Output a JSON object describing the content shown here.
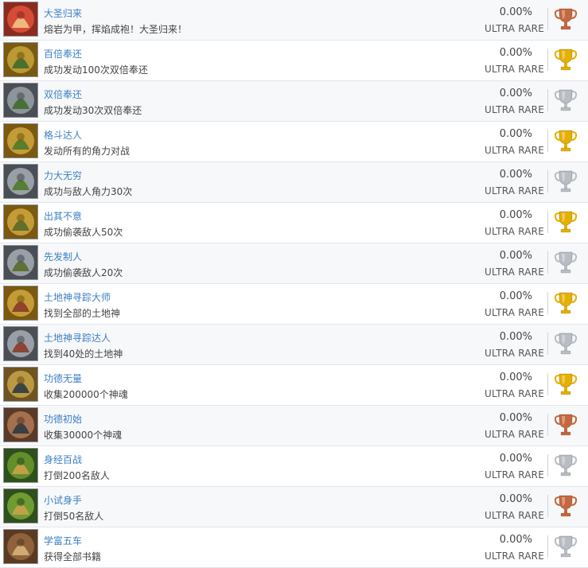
{
  "colors": {
    "title_link": "#3b7fc4",
    "gold": "#e6b000",
    "silver": "#b9bec4",
    "bronze": "#c6683f"
  },
  "achievements": [
    {
      "title": "大圣归来",
      "desc": "熔岩为甲，挥焰成袍！大圣归来！",
      "percent": "0.00%",
      "rarity": "ULTRA RARE",
      "trophy": "bronze",
      "icon": "monkey-king-red-icon"
    },
    {
      "title": "百倍奉还",
      "desc": "成功发动100次双倍奉还",
      "percent": "0.00%",
      "rarity": "ULTRA RARE",
      "trophy": "gold",
      "icon": "fighters-gold-icon"
    },
    {
      "title": "双倍奉还",
      "desc": "成功发动30次双倍奉还",
      "percent": "0.00%",
      "rarity": "ULTRA RARE",
      "trophy": "silver",
      "icon": "fighters-silver-icon"
    },
    {
      "title": "格斗达人",
      "desc": "发动所有的角力对战",
      "percent": "0.00%",
      "rarity": "ULTRA RARE",
      "trophy": "gold",
      "icon": "brawl-gold-icon"
    },
    {
      "title": "力大无穷",
      "desc": "成功与敌人角力30次",
      "percent": "0.00%",
      "rarity": "ULTRA RARE",
      "trophy": "silver",
      "icon": "brawl-silver-icon"
    },
    {
      "title": "出其不意",
      "desc": "成功偷袭敌人50次",
      "percent": "0.00%",
      "rarity": "ULTRA RARE",
      "trophy": "gold",
      "icon": "ambush-gold-icon"
    },
    {
      "title": "先发制人",
      "desc": "成功偷袭敌人20次",
      "percent": "0.00%",
      "rarity": "ULTRA RARE",
      "trophy": "silver",
      "icon": "ambush-silver-icon"
    },
    {
      "title": "土地神寻踪大师",
      "desc": "找到全部的土地神",
      "percent": "0.00%",
      "rarity": "ULTRA RARE",
      "trophy": "gold",
      "icon": "earth-god-gold-icon"
    },
    {
      "title": "土地神寻踪达人",
      "desc": "找到40处的土地神",
      "percent": "0.00%",
      "rarity": "ULTRA RARE",
      "trophy": "silver",
      "icon": "earth-god-silver-icon"
    },
    {
      "title": "功德无量",
      "desc": "收集200000个神魂",
      "percent": "0.00%",
      "rarity": "ULTRA RARE",
      "trophy": "gold",
      "icon": "spirit-gold-icon"
    },
    {
      "title": "功德初始",
      "desc": "收集30000个神魂",
      "percent": "0.00%",
      "rarity": "ULTRA RARE",
      "trophy": "bronze",
      "icon": "spirit-bronze-icon"
    },
    {
      "title": "身经百战",
      "desc": "打倒200名敌人",
      "percent": "0.00%",
      "rarity": "ULTRA RARE",
      "trophy": "silver",
      "icon": "warrior-green-icon"
    },
    {
      "title": "小试身手",
      "desc": "打倒50名敌人",
      "percent": "0.00%",
      "rarity": "ULTRA RARE",
      "trophy": "bronze",
      "icon": "warrior-green-small-icon"
    },
    {
      "title": "学富五车",
      "desc": "获得全部书籍",
      "percent": "0.00%",
      "rarity": "ULTRA RARE",
      "trophy": "silver",
      "icon": "books-icon"
    }
  ]
}
